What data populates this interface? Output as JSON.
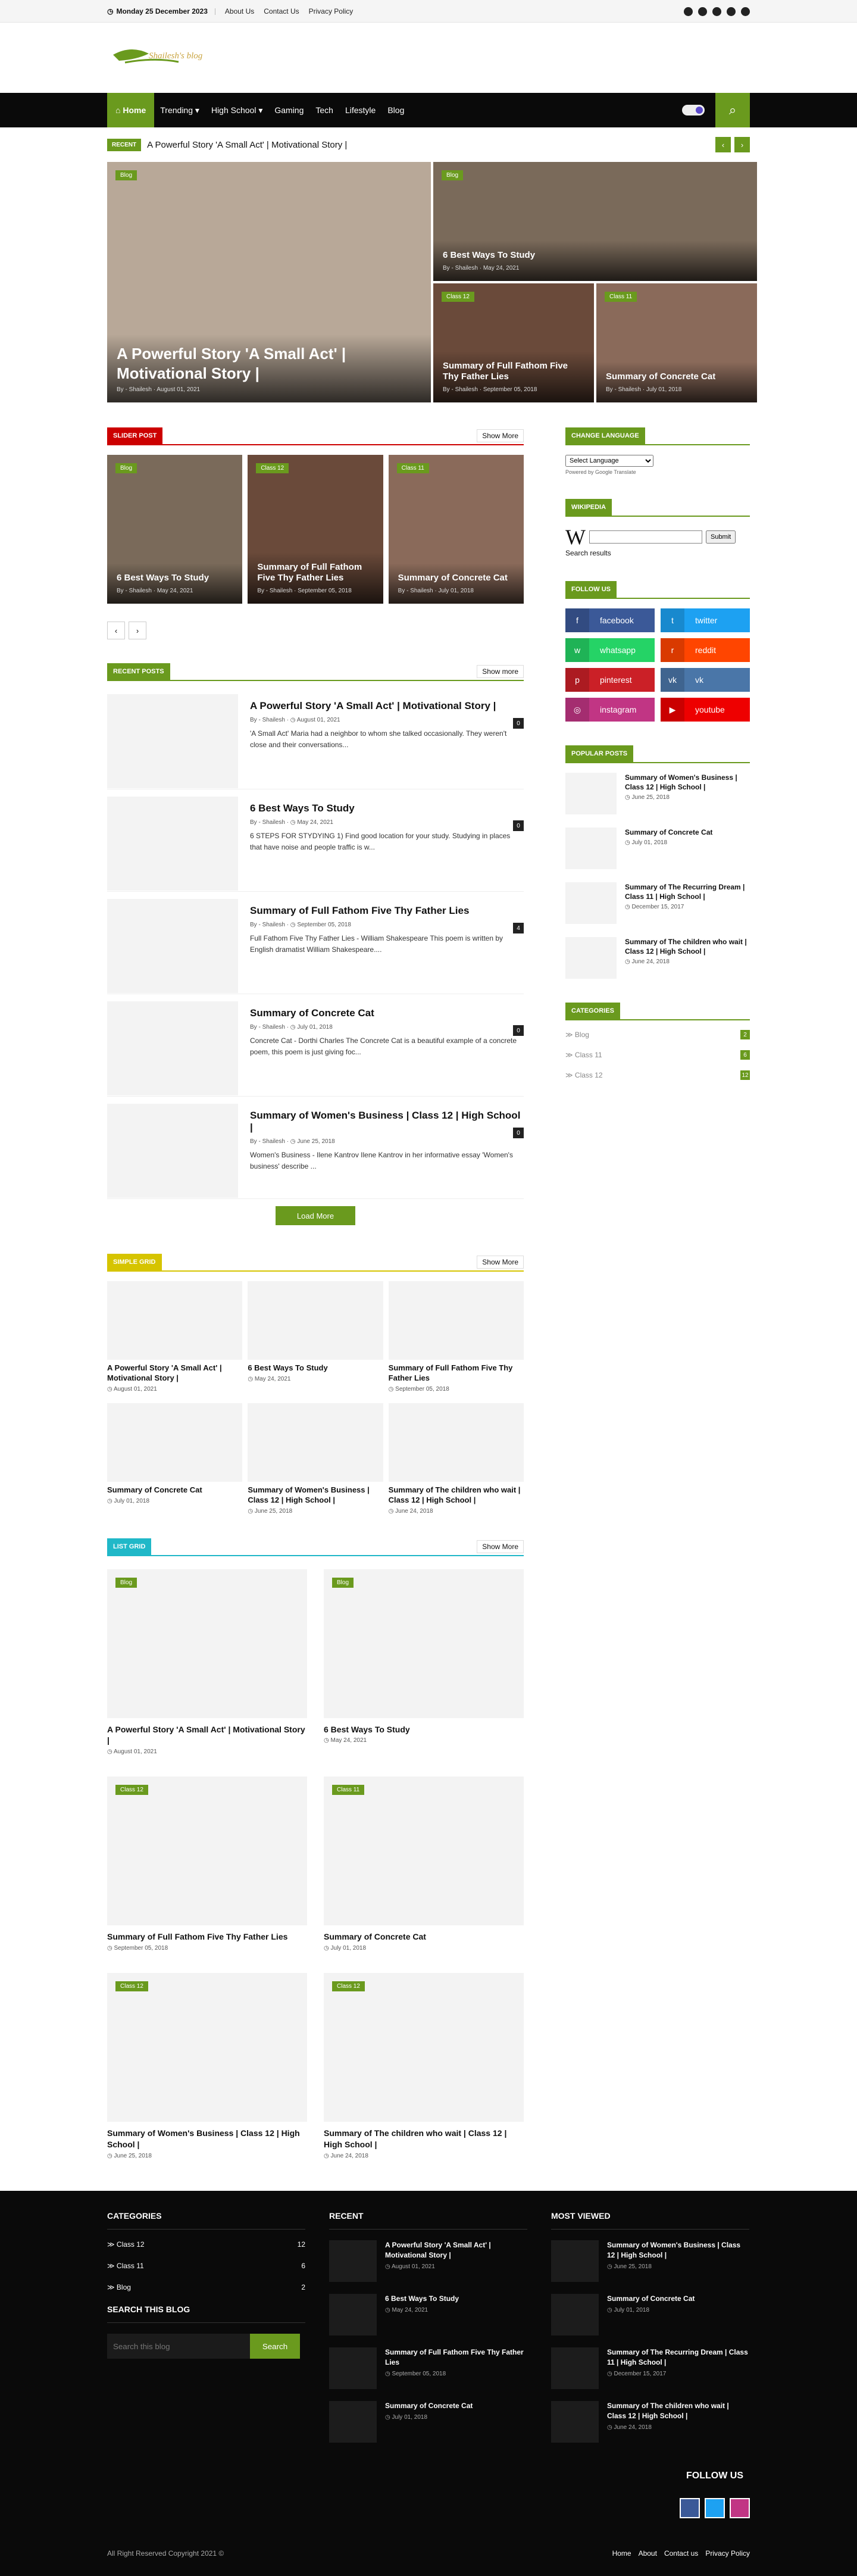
{
  "topbar": {
    "date": "Monday 25 December 2023",
    "links": [
      "About Us",
      "Contact Us",
      "Privacy Policy"
    ]
  },
  "nav": {
    "items": [
      "Home",
      "Trending",
      "High School",
      "Gaming",
      "Tech",
      "Lifestyle",
      "Blog"
    ]
  },
  "ticker": {
    "label": "RECENT",
    "text": "A Powerful Story 'A Small Act' | Motivational Story |"
  },
  "featured": [
    {
      "badge": "Blog",
      "title": "A Powerful Story 'A Small Act' | Motivational Story |",
      "author": "Shailesh",
      "date": "August 01, 2021"
    },
    {
      "badge": "Blog",
      "title": "6 Best Ways To Study",
      "author": "Shailesh",
      "date": "May 24, 2021"
    },
    {
      "badge": "Class 12",
      "title": "Summary of Full Fathom Five Thy Father Lies",
      "author": "Shailesh",
      "date": "September 05, 2018"
    },
    {
      "badge": "Class 11",
      "title": "Summary of Concrete Cat",
      "author": "Shailesh",
      "date": "July 01, 2018"
    }
  ],
  "slider": {
    "title": "SLIDER POST",
    "more": "Show More",
    "items": [
      {
        "badge": "Blog",
        "title": "6 Best Ways To Study",
        "author": "Shailesh",
        "date": "May 24, 2021"
      },
      {
        "badge": "Class 12",
        "title": "Summary of Full Fathom Five Thy Father Lies",
        "author": "Shailesh",
        "date": "September 05, 2018"
      },
      {
        "badge": "Class 11",
        "title": "Summary of Concrete Cat",
        "author": "Shailesh",
        "date": "July 01, 2018"
      }
    ]
  },
  "recent": {
    "title": "RECENT POSTS",
    "more": "Show more",
    "load": "Load More",
    "items": [
      {
        "title": "A Powerful Story 'A Small Act' | Motivational Story |",
        "author": "Shailesh",
        "date": "August 01, 2021",
        "count": "0",
        "excerpt": "'A Small Act' Maria had a neighbor to whom she talked occasionally. They weren't close and their conversations..."
      },
      {
        "title": "6 Best Ways To Study",
        "author": "Shailesh",
        "date": "May 24, 2021",
        "count": "0",
        "excerpt": "6 STEPS FOR STYDYING   1) Find good location for your study. Studying in places that have noise and people traffic is w..."
      },
      {
        "title": "Summary of Full Fathom Five Thy Father Lies",
        "author": "Shailesh",
        "date": "September 05, 2018",
        "count": "4",
        "excerpt": "Full Fathom Five Thy Father Lies - William Shakespeare This poem is written by English dramatist William Shakespeare...."
      },
      {
        "title": "Summary of Concrete Cat",
        "author": "Shailesh",
        "date": "July 01, 2018",
        "count": "0",
        "excerpt": "Concrete Cat - Dorthi Charles The Concrete Cat is a beautiful example of a concrete poem, this poem is just giving foc..."
      },
      {
        "title": "Summary of Women's Business | Class 12 | High School |",
        "author": "Shailesh",
        "date": "June 25, 2018",
        "count": "0",
        "excerpt": "Women's Business    - Ilene Kantrov Ilene Kantrov in her informative essay 'Women's business' describe ..."
      }
    ]
  },
  "simple": {
    "title": "SIMPLE GRID",
    "more": "Show More",
    "items": [
      {
        "title": "A Powerful Story 'A Small Act' | Motivational Story |",
        "date": "August 01, 2021"
      },
      {
        "title": "6 Best Ways To Study",
        "date": "May 24, 2021"
      },
      {
        "title": "Summary of Full Fathom Five Thy Father Lies",
        "date": "September 05, 2018"
      },
      {
        "title": "Summary of Concrete Cat",
        "date": "July 01, 2018"
      },
      {
        "title": "Summary of Women's Business | Class 12 | High School |",
        "date": "June 25, 2018"
      },
      {
        "title": "Summary of The children who wait | Class 12 | High School |",
        "date": "June 24, 2018"
      }
    ]
  },
  "list": {
    "title": "LIST GRID",
    "more": "Show More",
    "items": [
      {
        "badge": "Blog",
        "title": "A Powerful Story 'A Small Act' | Motivational Story |",
        "date": "August 01, 2021"
      },
      {
        "badge": "Blog",
        "title": "6 Best Ways To Study",
        "date": "May 24, 2021"
      },
      {
        "badge": "Class 12",
        "title": "Summary of Full Fathom Five Thy Father Lies",
        "date": "September 05, 2018"
      },
      {
        "badge": "Class 11",
        "title": "Summary of Concrete Cat",
        "date": "July 01, 2018"
      },
      {
        "badge": "Class 12",
        "title": "Summary of Women's Business | Class 12 | High School |",
        "date": "June 25, 2018"
      },
      {
        "badge": "Class 12",
        "title": "Summary of The children who wait | Class 12 | High School |",
        "date": "June 24, 2018"
      }
    ]
  },
  "side": {
    "lang_title": "CHANGE LANGUAGE",
    "lang_select": "Select Language",
    "lang_powered": "Powered by Google Translate",
    "wiki_title": "WIKIPEDIA",
    "wiki_submit": "Submit",
    "wiki_results": "Search results",
    "follow_title": "FOLLOW US",
    "follow": [
      [
        "facebook",
        "#3b5998"
      ],
      [
        "twitter",
        "#1da1f2"
      ],
      [
        "whatsapp",
        "#25d366"
      ],
      [
        "reddit",
        "#ff4500"
      ],
      [
        "pinterest",
        "#cb2027"
      ],
      [
        "vk",
        "#4a76a8"
      ],
      [
        "instagram",
        "#c13584"
      ],
      [
        "youtube",
        "#e00"
      ]
    ],
    "pop_title": "POPULAR POSTS",
    "pop": [
      {
        "title": "Summary of Women's Business | Class 12 | High School |",
        "date": "June 25, 2018"
      },
      {
        "title": "Summary of Concrete Cat",
        "date": "July 01, 2018"
      },
      {
        "title": "Summary of The Recurring Dream | Class 11 | High School |",
        "date": "December 15, 2017"
      },
      {
        "title": "Summary of The children who wait | Class 12 | High School |",
        "date": "June 24, 2018"
      }
    ],
    "cat_title": "CATEGORIES",
    "cats": [
      {
        "name": "Blog",
        "n": "2"
      },
      {
        "name": "Class 11",
        "n": "6"
      },
      {
        "name": "Class 12",
        "n": "12"
      }
    ]
  },
  "footer": {
    "cat_title": "CATEGORIES",
    "cats": [
      {
        "name": "Class 12",
        "n": "12"
      },
      {
        "name": "Class 11",
        "n": "6"
      },
      {
        "name": "Blog",
        "n": "2"
      }
    ],
    "search_title": "SEARCH THIS BLOG",
    "search_ph": "Search this blog",
    "search_btn": "Search",
    "recent_title": "RECENT",
    "recent": [
      {
        "title": "A Powerful Story 'A Small Act' | Motivational Story |",
        "date": "August 01, 2021"
      },
      {
        "title": "6 Best Ways To Study",
        "date": "May 24, 2021"
      },
      {
        "title": "Summary of Full Fathom Five Thy Father Lies",
        "date": "September 05, 2018"
      },
      {
        "title": "Summary of Concrete Cat",
        "date": "July 01, 2018"
      }
    ],
    "mv_title": "MOST VIEWED",
    "mv": [
      {
        "title": "Summary of Women's Business | Class 12 | High School |",
        "date": "June 25, 2018"
      },
      {
        "title": "Summary of Concrete Cat",
        "date": "July 01, 2018"
      },
      {
        "title": "Summary of The Recurring Dream | Class 11 | High School |",
        "date": "December 15, 2017"
      },
      {
        "title": "Summary of The children who wait | Class 12 | High School |",
        "date": "June 24, 2018"
      }
    ],
    "follow": "FOLLOW US",
    "copy": "All Right Reserved Copyright 2021 ©",
    "links": [
      "Home",
      "About",
      "Contact us",
      "Privacy Policy"
    ]
  }
}
